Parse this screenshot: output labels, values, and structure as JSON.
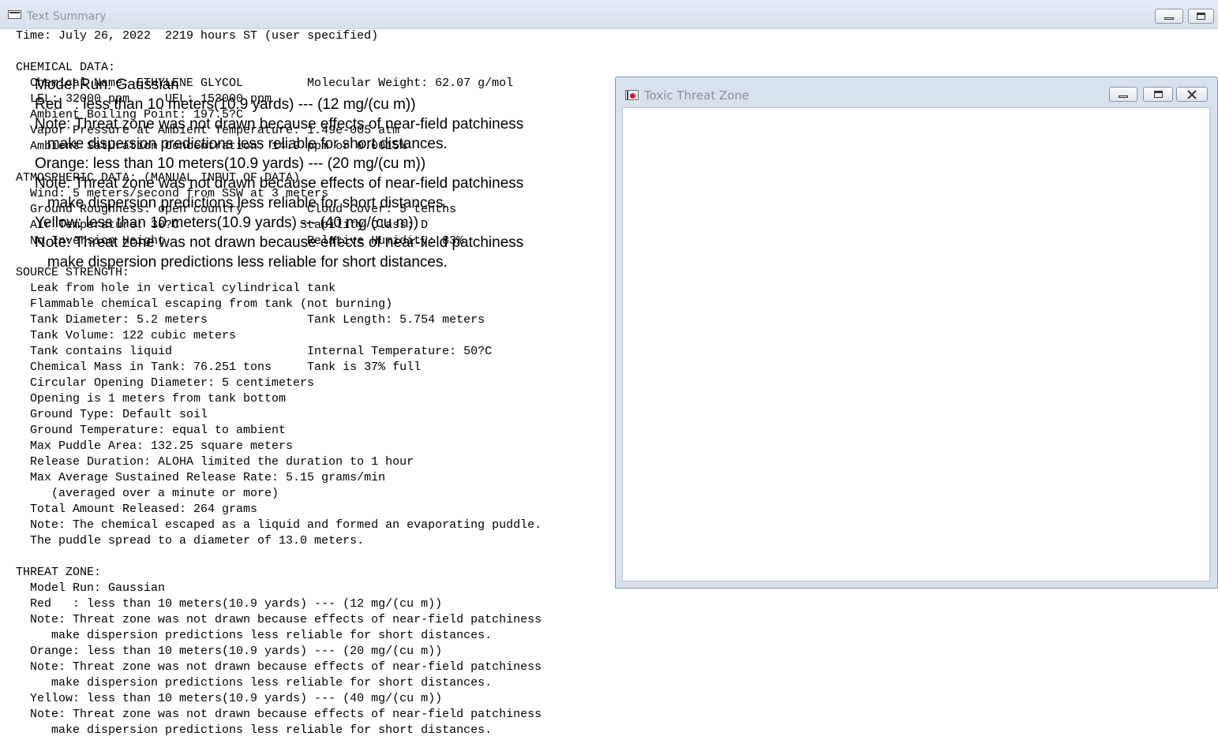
{
  "main_window": {
    "title": "Text Summary",
    "lines": [
      "Time: July 26, 2022  2219 hours ST (user specified)",
      "",
      "CHEMICAL DATA:",
      "  Chemical Name: ETHYLENE GLYCOL         Molecular Weight: 62.07 g/mol",
      "  LEL: 32000 ppm     UEL: 153000 ppm",
      "  Ambient Boiling Point: 197.5?C",
      "  Vapor Pressure at Ambient Temperature: 1.49e-005 atm",
      "  Ambient Saturation Concentration: 14.9 ppm or 0.0015%",
      "",
      "ATMOSPHERIC DATA: (MANUAL INPUT OF DATA)",
      "  Wind: 5 meters/second from SSW at 3 meters",
      "  Ground Roughness: open country         Cloud Cover: 5 tenths",
      "  Air Temperature: 30?C                 Stability Class: D",
      "  No Inversion Height                    Relative Humidity: 83%",
      "",
      "SOURCE STRENGTH:",
      "  Leak from hole in vertical cylindrical tank",
      "  Flammable chemical escaping from tank (not burning)",
      "  Tank Diameter: 5.2 meters              Tank Length: 5.754 meters",
      "  Tank Volume: 122 cubic meters",
      "  Tank contains liquid                   Internal Temperature: 50?C",
      "  Chemical Mass in Tank: 76.251 tons     Tank is 37% full",
      "  Circular Opening Diameter: 5 centimeters",
      "  Opening is 1 meters from tank bottom",
      "  Ground Type: Default soil",
      "  Ground Temperature: equal to ambient",
      "  Max Puddle Area: 132.25 square meters",
      "  Release Duration: ALOHA limited the duration to 1 hour",
      "  Max Average Sustained Release Rate: 5.15 grams/min",
      "     (averaged over a minute or more)",
      "  Total Amount Released: 264 grams",
      "  Note: The chemical escaped as a liquid and formed an evaporating puddle.",
      "  The puddle spread to a diameter of 13.0 meters.",
      "",
      "THREAT ZONE:",
      "  Model Run: Gaussian",
      "  Red   : less than 10 meters(10.9 yards) --- (12 mg/(cu m))",
      "  Note: Threat zone was not drawn because effects of near-field patchiness",
      "     make dispersion predictions less reliable for short distances.",
      "  Orange: less than 10 meters(10.9 yards) --- (20 mg/(cu m))",
      "  Note: Threat zone was not drawn because effects of near-field patchiness",
      "     make dispersion predictions less reliable for short distances.",
      "  Yellow: less than 10 meters(10.9 yards) --- (40 mg/(cu m))",
      "  Note: Threat zone was not drawn because effects of near-field patchiness",
      "     make dispersion predictions less reliable for short distances."
    ]
  },
  "threat_window": {
    "title": "Toxic Threat Zone",
    "lines": [
      "Model Run: Gaussian",
      "Red   : less than 10 meters(10.9 yards) --- (12 mg/(cu m))",
      "Note: Threat zone was not drawn because effects of near-field patchiness",
      "   make dispersion predictions less reliable for short distances.",
      "Orange: less than 10 meters(10.9 yards) --- (20 mg/(cu m))",
      "Note: Threat zone was not drawn because effects of near-field patchiness",
      "   make dispersion predictions less reliable for short distances.",
      "Yellow: less than 10 meters(10.9 yards) --- (40 mg/(cu m))",
      "Note: Threat zone was not drawn because effects of near-field patchiness",
      "   make dispersion predictions less reliable for short distances."
    ]
  },
  "icons": {
    "main_window_icon": "text-window-icon",
    "threat_window_icon": "threat-zone-app-icon",
    "minimize": "minimize-icon",
    "maximize": "maximize-icon",
    "close": "close-icon"
  }
}
